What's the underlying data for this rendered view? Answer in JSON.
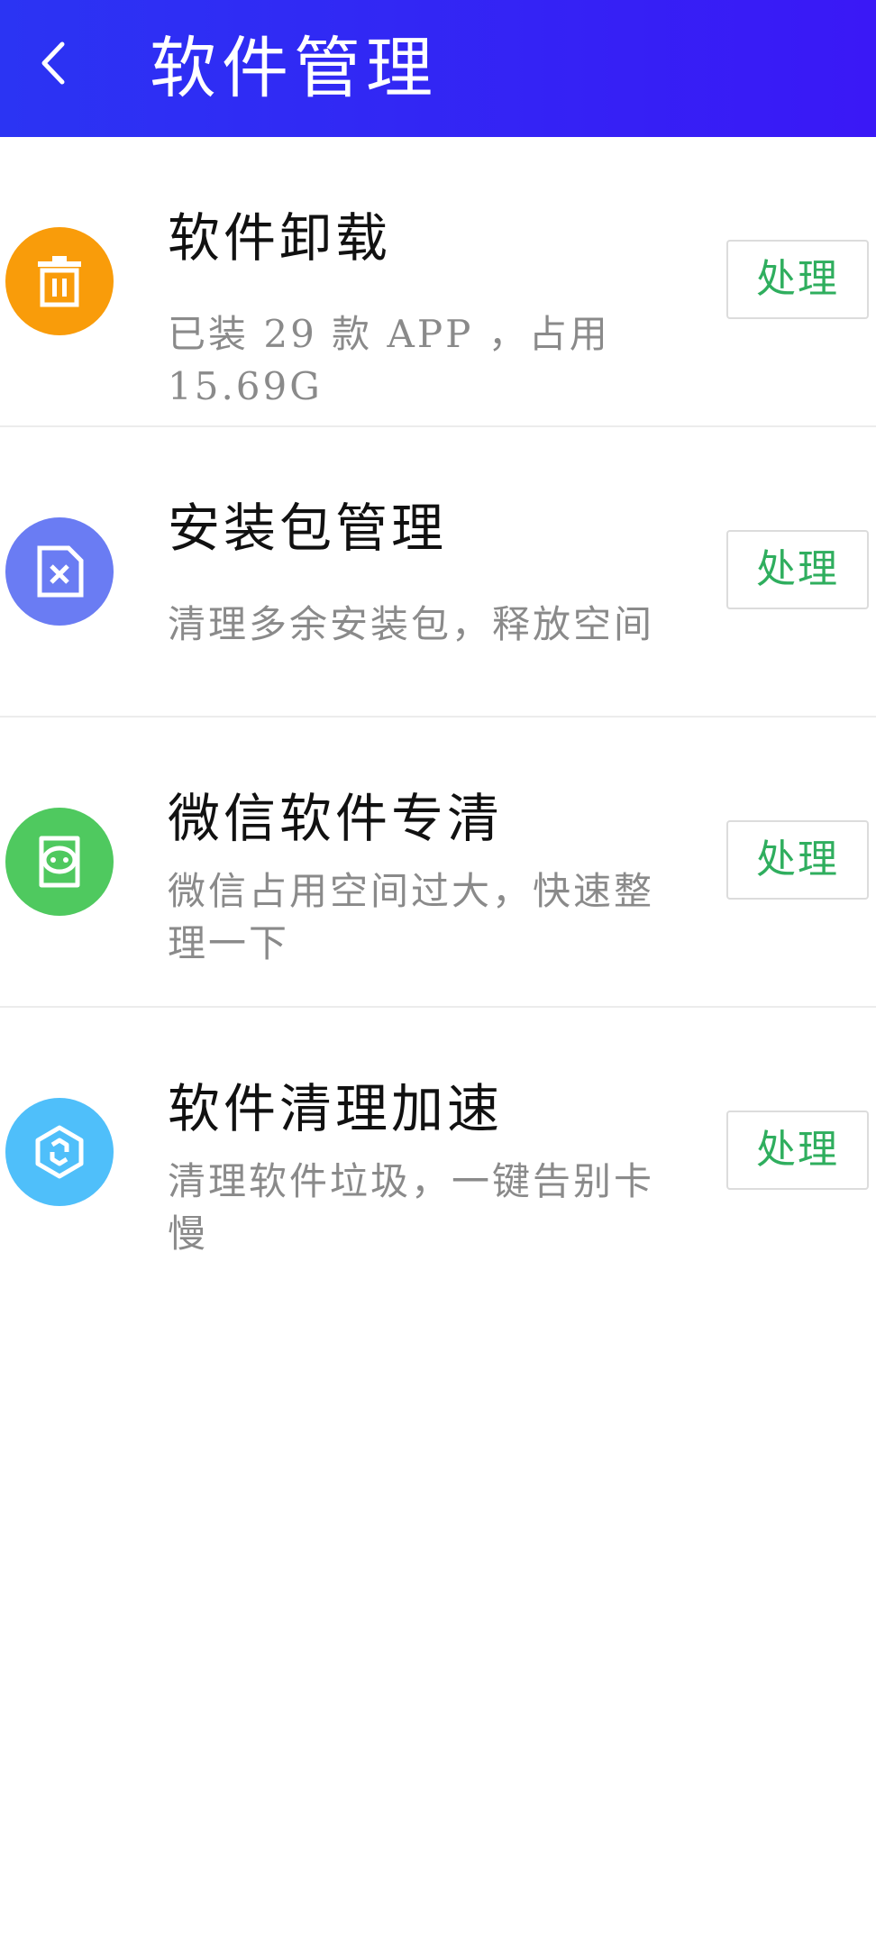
{
  "header": {
    "title": "软件管理",
    "gradient_start": "#2b34f3",
    "gradient_end": "#3a18f6"
  },
  "items": [
    {
      "title": "软件卸载",
      "desc": "已装 29 款 APP ，占用15.69G",
      "action": "处理",
      "icon": "trash-icon",
      "icon_color": "#f99c0a"
    },
    {
      "title": "安装包管理",
      "desc": "清理多余安装包，释放空间",
      "action": "处理",
      "icon": "package-icon",
      "icon_color": "#6a7cf3"
    },
    {
      "title": "微信软件专清",
      "desc": "微信占用空间过大，快速整理一下",
      "action": "处理",
      "icon": "chat-icon",
      "icon_color": "#4fc95f"
    },
    {
      "title": "软件清理加速",
      "desc": "清理软件垃圾，一键告别卡慢",
      "action": "处理",
      "icon": "hexagon-icon",
      "icon_color": "#4fbffa"
    }
  ],
  "action_color": "#2fae5e"
}
